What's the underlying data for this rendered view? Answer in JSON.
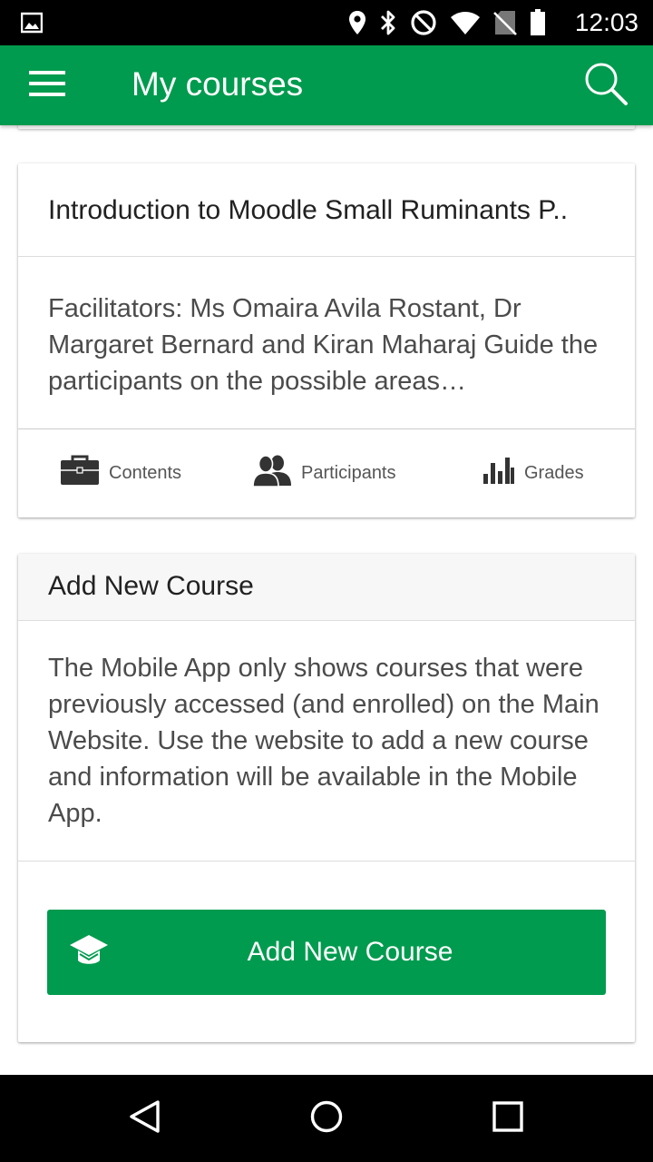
{
  "status_bar": {
    "time": "12:03",
    "icons": [
      "image-icon",
      "location-icon",
      "bluetooth-icon",
      "do-not-disturb-icon",
      "wifi-icon",
      "no-sim-icon",
      "battery-icon"
    ]
  },
  "app_bar": {
    "title": "My courses",
    "menu_icon": "menu-icon",
    "search_icon": "search-icon",
    "color": "#009b4e"
  },
  "course": {
    "title": "Introduction to Moodle Small Ruminants P..",
    "summary": "Facilitators: Ms Omaira Avila Rostant, Dr Margaret Bernard and Kiran Maharaj  Guide the participants on the possible areas…",
    "actions": [
      {
        "label": "Contents",
        "icon": "briefcase-icon"
      },
      {
        "label": "Participants",
        "icon": "people-icon"
      },
      {
        "label": "Grades",
        "icon": "bar-chart-icon"
      }
    ]
  },
  "add_course": {
    "header": "Add New Course",
    "text": "The Mobile App only shows courses that were previously accessed (and enrolled) on the Main Website. Use the website to add a new course and information will be available in the Mobile App.",
    "button_label": "Add New Course",
    "button_icon": "graduation-cap-icon"
  },
  "nav_bar": {
    "buttons": [
      "back-icon",
      "home-icon",
      "recents-icon"
    ]
  }
}
